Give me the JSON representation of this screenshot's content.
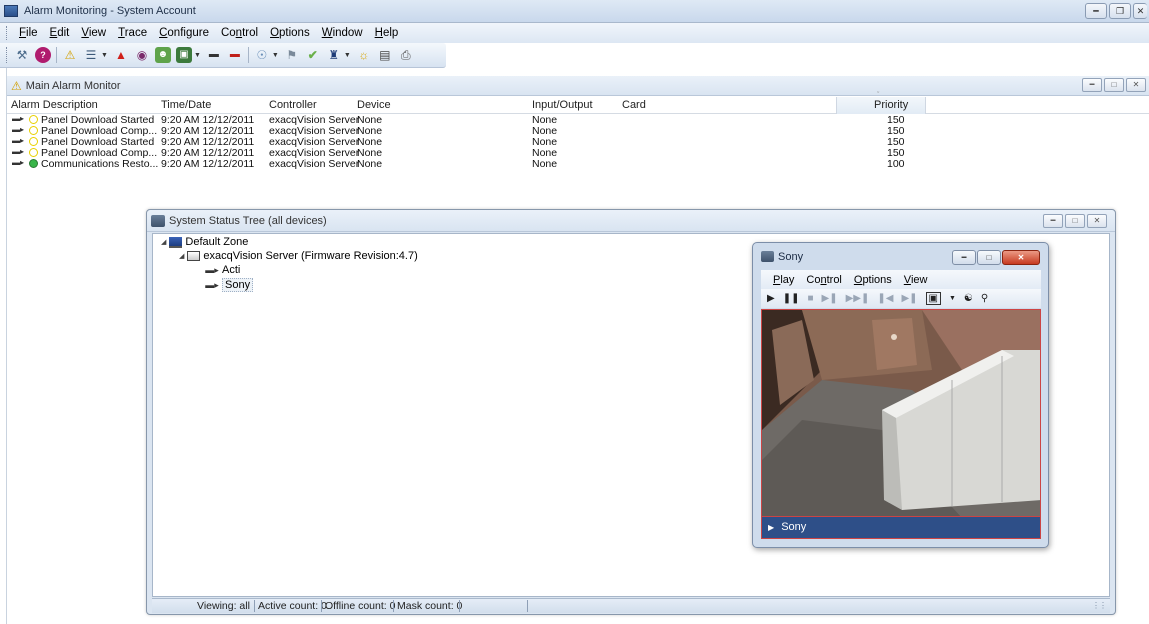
{
  "window": {
    "title": "Alarm Monitoring - System Account"
  },
  "menu": [
    {
      "key": "F",
      "rest": "ile"
    },
    {
      "key": "E",
      "rest": "dit"
    },
    {
      "key": "V",
      "rest": "iew"
    },
    {
      "key": "T",
      "rest": "race"
    },
    {
      "key": "C",
      "rest": "onfigure"
    },
    {
      "pre": "Co",
      "key": "n",
      "rest": "trol"
    },
    {
      "key": "O",
      "rest": "ptions"
    },
    {
      "key": "W",
      "rest": "indow"
    },
    {
      "key": "H",
      "rest": "elp"
    }
  ],
  "alarm_monitor": {
    "title": "Main Alarm Monitor",
    "columns": [
      "Alarm Description",
      "Time/Date",
      "Controller",
      "Device",
      "Input/Output",
      "Card",
      "Priority"
    ],
    "rows": [
      {
        "desc": "Panel Download Started",
        "time": "9:20 AM 12/12/2011",
        "controller": "exacqVision Server",
        "device": "None",
        "io": "None",
        "card": "",
        "priority": "150",
        "status": "yellow"
      },
      {
        "desc": "Panel Download Comp...",
        "time": "9:20 AM 12/12/2011",
        "controller": "exacqVision Server",
        "device": "None",
        "io": "None",
        "card": "",
        "priority": "150",
        "status": "yellow"
      },
      {
        "desc": "Panel Download Started",
        "time": "9:20 AM 12/12/2011",
        "controller": "exacqVision Server",
        "device": "None",
        "io": "None",
        "card": "",
        "priority": "150",
        "status": "yellow"
      },
      {
        "desc": "Panel Download Comp...",
        "time": "9:20 AM 12/12/2011",
        "controller": "exacqVision Server",
        "device": "None",
        "io": "None",
        "card": "",
        "priority": "150",
        "status": "yellow"
      },
      {
        "desc": "Communications Resto...",
        "time": "9:20 AM 12/12/2011",
        "controller": "exacqVision Server",
        "device": "None",
        "io": "None",
        "card": "",
        "priority": "100",
        "status": "green"
      }
    ]
  },
  "status_tree": {
    "title": "System Status Tree (all devices)",
    "zone": "Default Zone",
    "server": "exacqVision Server (Firmware Revision:4.7)",
    "cameras": [
      "Acti",
      "Sony"
    ],
    "status": {
      "viewing": "Viewing: all",
      "active": "Active count: 0",
      "offline": "Offline count: 0",
      "mask": "Mask count: 0"
    }
  },
  "player": {
    "title": "Sony",
    "menu": [
      {
        "key": "P",
        "rest": "lay"
      },
      {
        "pre": "Co",
        "key": "n",
        "rest": "trol"
      },
      {
        "key": "O",
        "rest": "ptions"
      },
      {
        "key": "V",
        "rest": "iew"
      }
    ],
    "camera_label": "Sony"
  },
  "colors": {
    "alarm_yellow": "#e8d000",
    "alarm_green": "#39b54a",
    "selection_blue": "#2e4f88"
  }
}
